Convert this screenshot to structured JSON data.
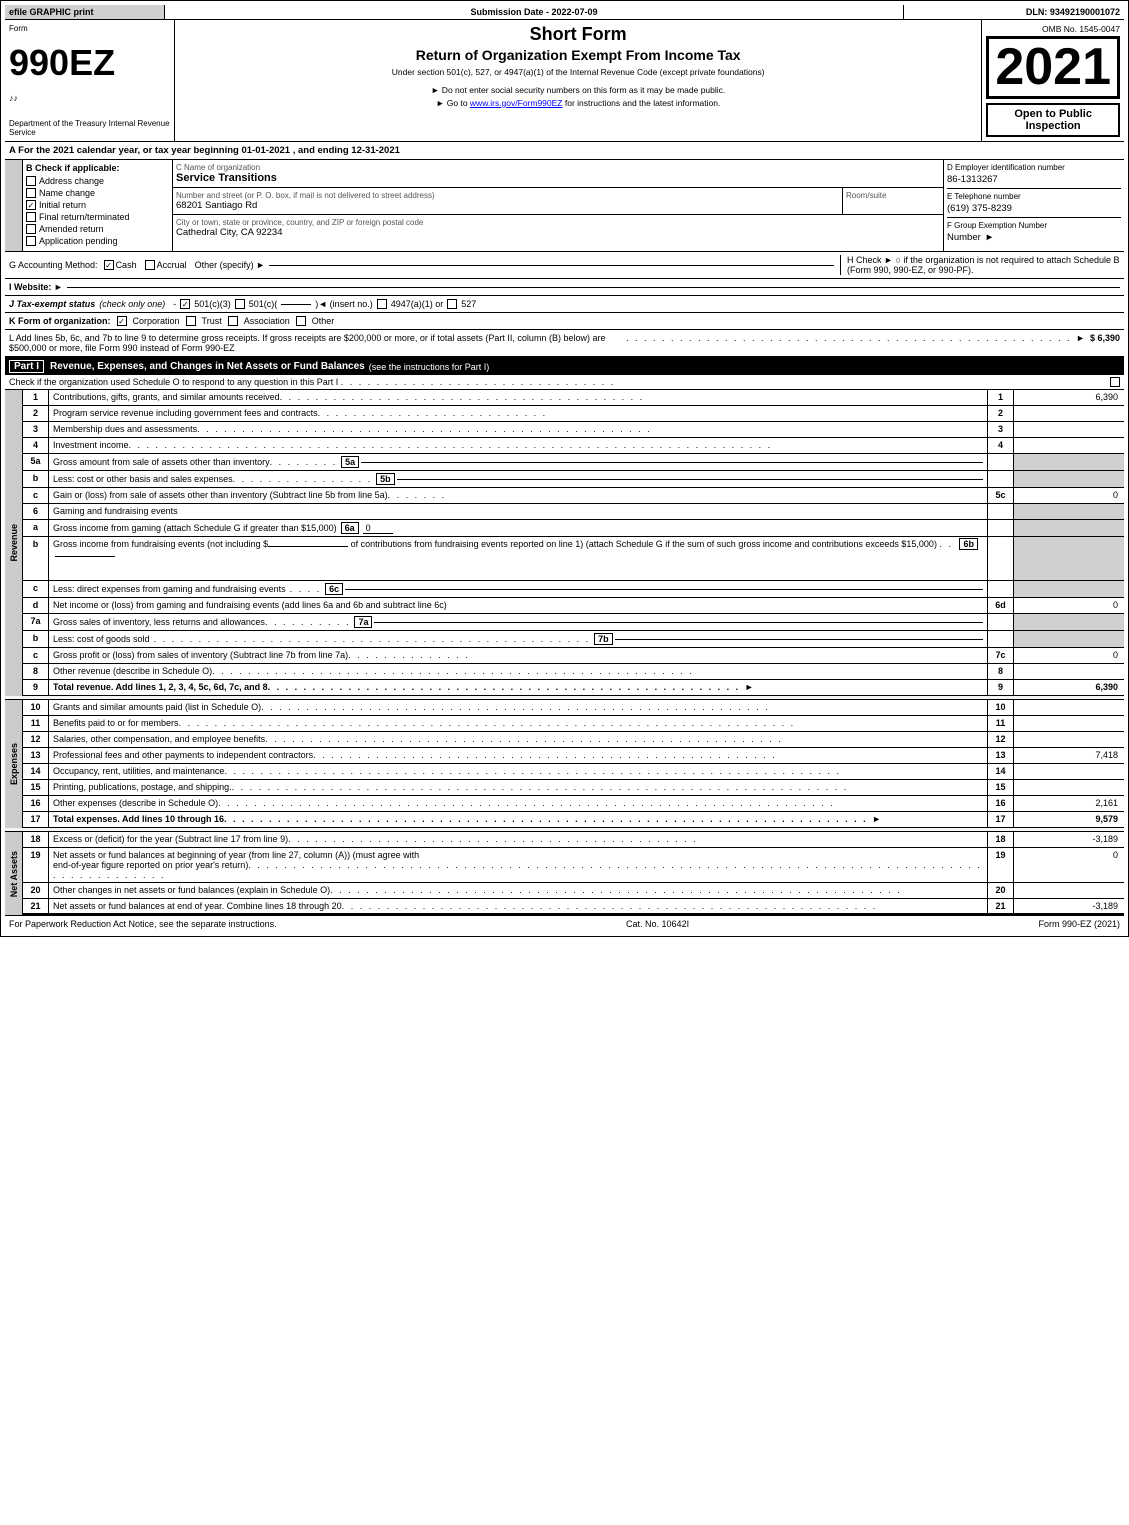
{
  "efile": {
    "label": "efile GRAPHIC print"
  },
  "submission": {
    "label": "Submission Date - 2022-07-09"
  },
  "dln": {
    "label": "DLN: 93492190001072"
  },
  "form": {
    "number": "990EZ",
    "sub1": "♪♪",
    "short_form": "Short Form",
    "return_title": "Return of Organization Exempt From Income Tax",
    "under_section": "Under section 501(c), 527, or 4947(a)(1) of the Internal Revenue Code (except private foundations)",
    "no_ssn": "► Do not enter social security numbers on this form as it may be made public.",
    "goto": "► Go to ",
    "goto_url": "www.irs.gov/Form990EZ",
    "goto_end": " for instructions and the latest information.",
    "omb": "OMB No. 1545-0047",
    "year": "2021",
    "open_public": "Open to Public Inspection",
    "dept": "Department of the Treasury Internal Revenue Service"
  },
  "tax_year": {
    "text": "A  For the 2021 calendar year, or tax year beginning 01-01-2021 , and ending 12-31-2021"
  },
  "section_b": {
    "label": "B  Check if applicable:",
    "items": [
      {
        "label": "Address change",
        "checked": false
      },
      {
        "label": "Name change",
        "checked": false
      },
      {
        "label": "Initial return",
        "checked": true
      },
      {
        "label": "Final return/terminated",
        "checked": false
      },
      {
        "label": "Amended return",
        "checked": false
      },
      {
        "label": "Application pending",
        "checked": false
      }
    ]
  },
  "section_c": {
    "name_label": "C  Name of organization",
    "name_value": "Service Transitions",
    "address_label": "Number and street (or P. O. box, if mail is not delivered to street address)",
    "address_value": "68201 Santiago Rd",
    "room_label": "Room/suite",
    "room_value": "",
    "city_label": "City or town, state or province, country, and ZIP or foreign postal code",
    "city_value": "Cathedral City, CA  92234"
  },
  "section_d": {
    "ein_label": "D  Employer identification number",
    "ein_value": "86-1313267",
    "phone_label": "E  Telephone number",
    "phone_value": "(619) 375-8239",
    "group_label": "F  Group Exemption Number",
    "group_arrow": "►"
  },
  "section_g": {
    "label": "G  Accounting Method:",
    "cash_label": "Cash",
    "cash_checked": true,
    "accrual_label": "Accrual",
    "accrual_checked": false,
    "other_label": "Other (specify) ►",
    "other_line": "___________________________"
  },
  "section_h": {
    "label": "H  Check ►",
    "text": "○  if the organization is not required to attach Schedule B (Form 990, 990-EZ, or 990-PF)."
  },
  "section_i": {
    "label": "I  Website: ►"
  },
  "section_j": {
    "label": "J  Tax-exempt status",
    "check_note": "(check only one)",
    "options": [
      {
        "label": "501(c)(3)",
        "checked": true
      },
      {
        "label": "501(c)(",
        "checked": false
      },
      {
        "label": ")◄ (insert no.)",
        "checked": false
      },
      {
        "label": "4947(a)(1) or",
        "checked": false
      },
      {
        "label": "527",
        "checked": false
      }
    ]
  },
  "section_k": {
    "label": "K  Form of organization:",
    "options": [
      {
        "label": "Corporation",
        "checked": true
      },
      {
        "label": "Trust",
        "checked": false
      },
      {
        "label": "Association",
        "checked": false
      },
      {
        "label": "Other",
        "checked": false
      }
    ]
  },
  "section_l": {
    "text": "L  Add lines 5b, 6c, and 7b to line 9 to determine gross receipts. If gross receipts are $200,000 or more, or if total assets (Part II, column (B) below) are $500,000 or more, file Form 990 instead of Form 990-EZ",
    "dots": ". . . . . . . . . . . . . . . . . . . . . . . . . . . . . . . . . . . . . . . . . . . . . . . . . . ►",
    "value": "$ 6,390"
  },
  "part1": {
    "label": "Part I",
    "title": "Revenue, Expenses, and Changes in Net Assets or Fund Balances",
    "see_instructions": "(see the instructions for Part I)",
    "check_note": "Check if the organization used Schedule O to respond to any question in this Part I",
    "check_dots": ". . . . . . . . . . . . . . . . . . . . . . . . . . . . . . .",
    "check_box": "□"
  },
  "revenue_lines": [
    {
      "num": "1",
      "desc": "Contributions, gifts, grants, and similar amounts received",
      "dots": ". . . . . . . . . . . . . . . . . . . . . . . . . . . . . . . . . . . . . . . . .",
      "linenum": "1",
      "value": "6,390"
    },
    {
      "num": "2",
      "desc": "Program service revenue including government fees and contracts",
      "dots": ". . . . . . . . . . . . . . . . . . . . . . . . . .",
      "linenum": "2",
      "value": ""
    },
    {
      "num": "3",
      "desc": "Membership dues and assessments",
      "dots": ". . . . . . . . . . . . . . . . . . . . . . . . . . . . . . . . . . . . . . . . . . . . . . . . . . .",
      "linenum": "3",
      "value": ""
    },
    {
      "num": "4",
      "desc": "Investment income",
      "dots": ". . . . . . . . . . . . . . . . . . . . . . . . . . . . . . . . . . . . . . . . . . . . . . . . . . . . . . . . . . . . . . . . . . . . . . . .",
      "linenum": "4",
      "value": ""
    },
    {
      "num": "5a",
      "desc": "Gross amount from sale of assets other than inventory",
      "dots": ". . . . . . . .",
      "subnum": "5a",
      "value": ""
    },
    {
      "num": "5b",
      "desc": "Less: cost or other basis and sales expenses",
      "dots": ". . . . . . . . . . . . . . . .",
      "subnum": "5b",
      "value": ""
    },
    {
      "num": "5c",
      "desc": "Gain or (loss) from sale of assets other than inventory (Subtract line 5b from line 5a)",
      "dots": ". . . . . . .",
      "linenum": "5c",
      "value": "0"
    },
    {
      "num": "6",
      "desc": "Gaming and fundraising events",
      "dots": "",
      "linenum": "",
      "value": ""
    },
    {
      "num": "6a",
      "desc": "Gross income from gaming (attach Schedule G if greater than $15,000)",
      "subnum": "6a",
      "subval": "0",
      "value": ""
    },
    {
      "num": "6b",
      "desc": "Gross income from fundraising events (not including $___________  of contributions from fundraising events reported on line 1) (attach Schedule G if the sum of such gross income and contributions exceeds $15,000)",
      "dots": ". .",
      "subnum": "6b",
      "value": ""
    },
    {
      "num": "6c",
      "desc": "Less: direct expenses from gaming and fundraising events",
      "dots": ". . . .",
      "subnum": "6c",
      "value": ""
    },
    {
      "num": "6d",
      "desc": "Net income or (loss) from gaming and fundraising events (add lines 6a and 6b and subtract line 6c)",
      "linenum": "6d",
      "value": "0"
    },
    {
      "num": "7a",
      "desc": "Gross sales of inventory, less returns and allowances",
      "dots": ". . . . . . . . . .",
      "subnum": "7a",
      "value": ""
    },
    {
      "num": "7b",
      "desc": "Less: cost of goods sold",
      "dots": ". . . . . . . . . . . . . . . . . . . . . . . . . . . . . . . . . . . . . . . . . . . . . . . . .",
      "subnum": "7b",
      "value": ""
    },
    {
      "num": "7c",
      "desc": "Gross profit or (loss) from sales of inventory (Subtract line 7b from line 7a)",
      "dots": ". . . . . . . . . . . . . .",
      "linenum": "7c",
      "value": "0"
    },
    {
      "num": "8",
      "desc": "Other revenue (describe in Schedule O)",
      "dots": ". . . . . . . . . . . . . . . . . . . . . . . . . . . . . . . . . . . . . . . . . . . . . . . . . . . . . .",
      "linenum": "8",
      "value": ""
    },
    {
      "num": "9",
      "desc": "Total revenue. Add lines 1, 2, 3, 4, 5c, 6d, 7c, and 8",
      "dots": ". . . . . . . . . . . . . . . . . . . . . . . . . . . . . . . . . . . . . . . . . . . . . . . . . . . . . ►",
      "linenum": "9",
      "value": "6,390",
      "bold": true
    }
  ],
  "expense_lines": [
    {
      "num": "10",
      "desc": "Grants and similar amounts paid (list in Schedule O)",
      "dots": ". . . . . . . . . . . . . . . . . . . . . . . . . . . . . . . . . . . . . . . . . . . . . . . . . . . . . . . . .",
      "linenum": "10",
      "value": ""
    },
    {
      "num": "11",
      "desc": "Benefits paid to or for members",
      "dots": ". . . . . . . . . . . . . . . . . . . . . . . . . . . . . . . . . . . . . . . . . . . . . . . . . . . . . . . . . . . . . . . . . . . . .",
      "linenum": "11",
      "value": ""
    },
    {
      "num": "12",
      "desc": "Salaries, other compensation, and employee benefits",
      "dots": ". . . . . . . . . . . . . . . . . . . . . . . . . . . . . . . . . . . . . . . . . . . . . . . . . . . . . . . . . .",
      "linenum": "12",
      "value": ""
    },
    {
      "num": "13",
      "desc": "Professional fees and other payments to independent contractors",
      "dots": ". . . . . . . . . . . . . . . . . . . . . . . . . . . . . . . . . . . . . . . . . . . . . . . . . . . .",
      "linenum": "13",
      "value": "7,418"
    },
    {
      "num": "14",
      "desc": "Occupancy, rent, utilities, and maintenance",
      "dots": ". . . . . . . . . . . . . . . . . . . . . . . . . . . . . . . . . . . . . . . . . . . . . . . . . . . . . . . . . . . . . . . . . . . . .",
      "linenum": "14",
      "value": ""
    },
    {
      "num": "15",
      "desc": "Printing, publications, postage, and shipping.",
      "dots": ". . . . . . . . . . . . . . . . . . . . . . . . . . . . . . . . . . . . . . . . . . . . . . . . . . . . . . . . . . . . . . . . . . . . .",
      "linenum": "15",
      "value": ""
    },
    {
      "num": "16",
      "desc": "Other expenses (describe in Schedule O)",
      "dots": ". . . . . . . . . . . . . . . . . . . . . . . . . . . . . . . . . . . . . . . . . . . . . . . . . . . . . . . . . . . . . . . . . . . . .",
      "linenum": "16",
      "value": "2,161"
    },
    {
      "num": "17",
      "desc": "Total expenses. Add lines 10 through 16",
      "dots": ". . . . . . . . . . . . . . . . . . . . . . . . . . . . . . . . . . . . . . . . . . . . . . . . . . . . . . . . . . . . . . . . . . . . . . . . ►",
      "linenum": "17",
      "value": "9,579",
      "bold": true
    }
  ],
  "asset_lines": [
    {
      "num": "18",
      "desc": "Excess or (deficit) for the year (Subtract line 17 from line 9)",
      "dots": ". . . . . . . . . . . . . . . . . . . . . . . . . . . . . . . . . . . . . . . . . . . . . .",
      "linenum": "18",
      "value": "-3,189"
    },
    {
      "num": "19",
      "desc": "Net assets or fund balances at beginning of year (from line 27, column (A)) (must agree with end-of-year figure reported on prior year's return)",
      "dots": ". . . . . . . . . . . . . . . . . . . . . . . . . . . . . . . . . . . . . . . . . . . . . . . . . . . . . . . . . . . . . . . . . . . . . . . . . . . . . . . . . . . . . . . . . . . . . . .",
      "linenum": "19",
      "value": "0"
    },
    {
      "num": "20",
      "desc": "Other changes in net assets or fund balances (explain in Schedule O)",
      "dots": ". . . . . . . . . . . . . . . . . . . . . . . . . . . . . . . . . . . . . . . . . . . . . . . . . . . . . . . . . . . . . . . .",
      "linenum": "20",
      "value": ""
    },
    {
      "num": "21",
      "desc": "Net assets or fund balances at end of year. Combine lines 18 through 20",
      "dots": ". . . . . . . . . . . . . . . . . . . . . . . . . . . . . . . . . . . . . . . . . . . . . . . . . . . . . . . . . . . .",
      "linenum": "21",
      "value": "-3,189"
    }
  ],
  "footer": {
    "paperwork": "For Paperwork Reduction Act Notice, see the separate instructions.",
    "cat_no": "Cat. No. 10642I",
    "form_ref": "Form 990-EZ (2021)"
  }
}
